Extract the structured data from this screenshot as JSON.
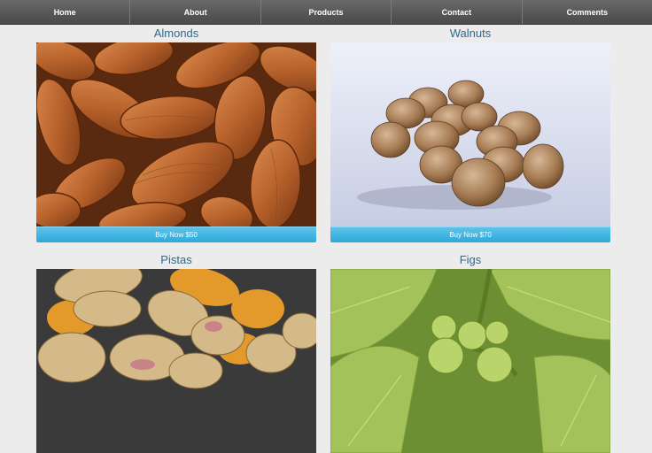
{
  "nav": {
    "items": [
      {
        "label": "Home"
      },
      {
        "label": "About"
      },
      {
        "label": "Products"
      },
      {
        "label": "Contact"
      },
      {
        "label": "Comments"
      }
    ]
  },
  "products": [
    {
      "name": "Almonds",
      "button": "Buy Now $50",
      "image": "almonds-photo"
    },
    {
      "name": "Walnuts",
      "button": "Buy Now $70",
      "image": "walnuts-photo"
    },
    {
      "name": "Pistas",
      "image": "pistachios-photo"
    },
    {
      "name": "Figs",
      "image": "figs-photo"
    }
  ]
}
